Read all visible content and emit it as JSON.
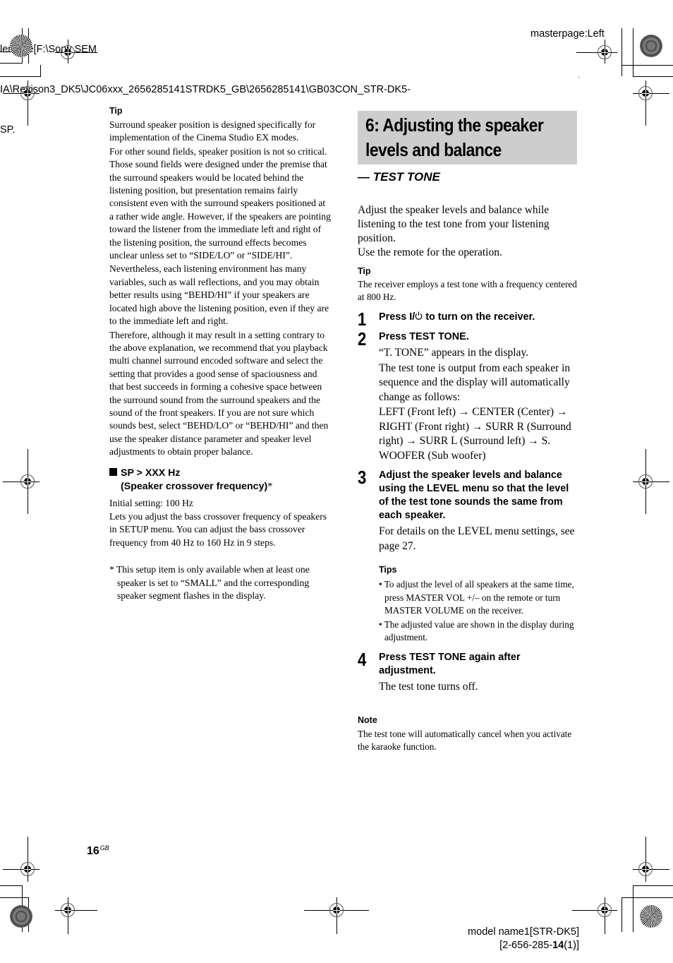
{
  "print_header": {
    "filename_lines": [
      "lename[F:\\Sony SEM",
      "IA\\Revison3_DK5\\JC06xxx_2656285141STRDK5_GB\\2656285141\\GB03CON_STR-DK5-",
      "SP."
    ],
    "masterpage": "masterpage:Left"
  },
  "left_column": {
    "tip_label": "Tip",
    "tip_paragraphs": [
      "Surround speaker position is designed specifically for implementation of the Cinema Studio EX modes.",
      "For other sound fields, speaker position is not so critical. Those sound fields were designed under the premise that the surround speakers would be located behind the listening position, but presentation remains fairly consistent even with the surround speakers positioned at a rather wide angle. However, if the speakers are pointing toward the listener from the immediate left and right of the listening position, the surround effects becomes unclear unless set to “SIDE/LO” or “SIDE/HI”.",
      "Nevertheless, each listening environment has many variables, such as wall reflections, and you may obtain better results using “BEHD/HI” if your speakers are located high above the listening position, even if they are to the immediate left and right.",
      "Therefore, although it may result in a setting contrary to the above explanation, we recommend that you playback multi channel surround encoded software and select the setting that provides a good sense of spaciousness and that best succeeds in forming a cohesive space between the surround sound from the surround speakers and the sound of the front speakers. If you are not sure which sounds best, select “BEHD/LO” or “BEHD/HI” and then use the speaker distance parameter and speaker level adjustments to obtain proper balance."
    ],
    "section": {
      "title_line1": "SP > XXX Hz",
      "title_line2": "(Speaker crossover frequency)",
      "asterisk": "*",
      "initial_setting": "Initial setting: 100 Hz",
      "description": "Lets you adjust the bass crossover frequency of speakers in SETUP menu. You can adjust the bass crossover frequency from 40 Hz to 160 Hz in 9 steps."
    },
    "footnote": "* This setup item is only available when at least one speaker is set to “SMALL” and the corresponding speaker segment flashes in the display."
  },
  "right_column": {
    "title": "6: Adjusting the speaker levels and balance",
    "subtitle": "— TEST TONE",
    "intro_lines": [
      "Adjust the speaker levels and balance while listening to the test tone from your listening position.",
      "Use the remote for the operation."
    ],
    "tip_label": "Tip",
    "tip_text": "The receiver employs a test tone with a frequency centered at 800 Hz.",
    "steps": [
      {
        "number": "1",
        "title_before_icon": "Press I/",
        "icon": "power-icon",
        "title_after_icon": " to turn on the receiver."
      },
      {
        "number": "2",
        "title": "Press TEST TONE.",
        "body": [
          "“T. TONE” appears in the display.",
          "The test tone is output from each speaker in sequence and the display will automatically change as follows:",
          "LEFT (Front left) → CENTER (Center) → RIGHT (Front right) → SURR R (Surround right) → SURR L (Surround left) → S. WOOFER (Sub woofer)"
        ]
      },
      {
        "number": "3",
        "title": "Adjust the speaker levels and balance using the LEVEL menu so that the level of the test tone sounds the same from each speaker.",
        "body": [
          "For details on the LEVEL menu settings, see page 27."
        ],
        "tips_label": "Tips",
        "tips": [
          "To adjust the level of all speakers at the same time, press MASTER VOL +/– on the remote or turn MASTER VOLUME on the receiver.",
          "The adjusted value are shown in the display during adjustment."
        ]
      },
      {
        "number": "4",
        "title": "Press TEST TONE again after adjustment.",
        "body": [
          "The test tone turns off."
        ]
      }
    ],
    "note_label": "Note",
    "note_text": "The test tone will automatically cancel when you activate the karaoke function."
  },
  "footer": {
    "page_number": "16",
    "page_suffix": "GB",
    "model_line1": "model name1[STR-DK5]",
    "model_line2_prefix": "[2-656-285-",
    "model_line2_bold": "14",
    "model_line2_suffix": "(1)]"
  }
}
